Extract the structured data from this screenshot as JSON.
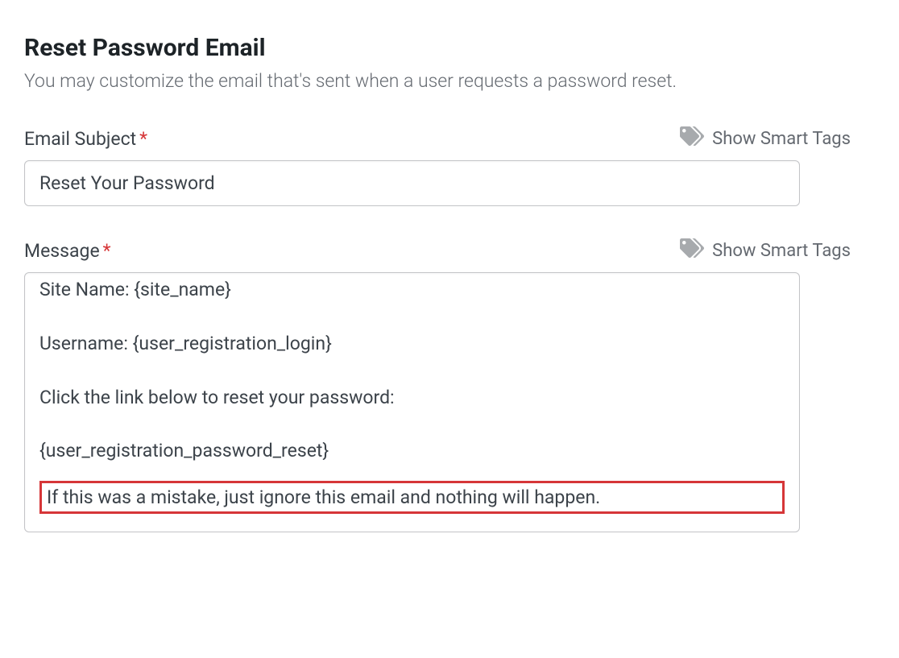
{
  "header": {
    "title": "Reset Password Email",
    "description": "You may customize the email that's sent when a user requests a password reset."
  },
  "smart_tags_label": "Show Smart Tags",
  "fields": {
    "subject": {
      "label": "Email Subject",
      "value": "Reset Your Password"
    },
    "message": {
      "label": "Message",
      "body_top": "Site Name: {site_name}\n\nUsername: {user_registration_login}\n\nClick the link below to reset your password:\n\n{user_registration_password_reset}",
      "body_highlighted": "If this was a mistake, just ignore this email and nothing will happen."
    }
  }
}
